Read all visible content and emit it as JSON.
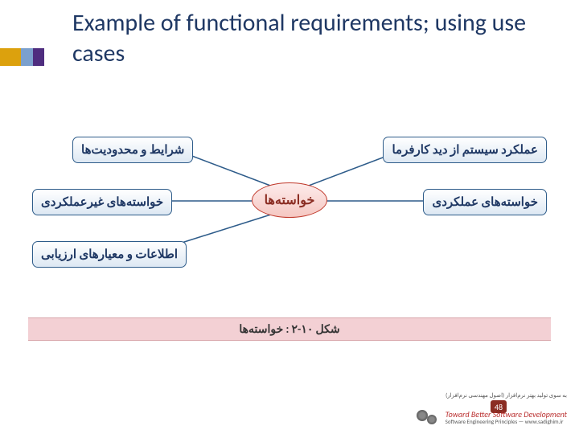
{
  "title": "Example of functional requirements; using use cases",
  "diagram": {
    "center": "خواسته‌ها",
    "boxes": {
      "top_right": "عملکرد سیستم از دید کارفرما",
      "top_left": "شرایط و محدودیت‌ها",
      "mid_right": "خواسته‌های عملکردی",
      "mid_left": "خواسته‌های غیرعملکردی",
      "bot_left": "اطلاعات و معیارهای ارزیابی"
    },
    "caption": "شکل ۱۰-۲ : خواسته‌ها"
  },
  "footer": {
    "tagline_fa": "به سوی تولید بهتر نرم‌افزار (اصول مهندسی نرم‌افزار)",
    "logo_line1": "Toward Better Software Development",
    "logo_line2": "Software Engineering Principles  —  www.sadighim.ir",
    "page": "48"
  }
}
